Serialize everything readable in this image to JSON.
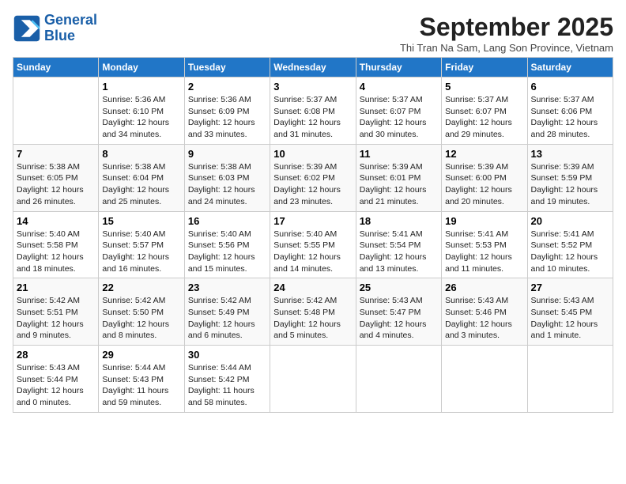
{
  "logo": {
    "line1": "General",
    "line2": "Blue"
  },
  "title": "September 2025",
  "subtitle": "Thi Tran Na Sam, Lang Son Province, Vietnam",
  "weekdays": [
    "Sunday",
    "Monday",
    "Tuesday",
    "Wednesday",
    "Thursday",
    "Friday",
    "Saturday"
  ],
  "weeks": [
    [
      {
        "day": "",
        "text": ""
      },
      {
        "day": "1",
        "text": "Sunrise: 5:36 AM\nSunset: 6:10 PM\nDaylight: 12 hours\nand 34 minutes."
      },
      {
        "day": "2",
        "text": "Sunrise: 5:36 AM\nSunset: 6:09 PM\nDaylight: 12 hours\nand 33 minutes."
      },
      {
        "day": "3",
        "text": "Sunrise: 5:37 AM\nSunset: 6:08 PM\nDaylight: 12 hours\nand 31 minutes."
      },
      {
        "day": "4",
        "text": "Sunrise: 5:37 AM\nSunset: 6:07 PM\nDaylight: 12 hours\nand 30 minutes."
      },
      {
        "day": "5",
        "text": "Sunrise: 5:37 AM\nSunset: 6:07 PM\nDaylight: 12 hours\nand 29 minutes."
      },
      {
        "day": "6",
        "text": "Sunrise: 5:37 AM\nSunset: 6:06 PM\nDaylight: 12 hours\nand 28 minutes."
      }
    ],
    [
      {
        "day": "7",
        "text": "Sunrise: 5:38 AM\nSunset: 6:05 PM\nDaylight: 12 hours\nand 26 minutes."
      },
      {
        "day": "8",
        "text": "Sunrise: 5:38 AM\nSunset: 6:04 PM\nDaylight: 12 hours\nand 25 minutes."
      },
      {
        "day": "9",
        "text": "Sunrise: 5:38 AM\nSunset: 6:03 PM\nDaylight: 12 hours\nand 24 minutes."
      },
      {
        "day": "10",
        "text": "Sunrise: 5:39 AM\nSunset: 6:02 PM\nDaylight: 12 hours\nand 23 minutes."
      },
      {
        "day": "11",
        "text": "Sunrise: 5:39 AM\nSunset: 6:01 PM\nDaylight: 12 hours\nand 21 minutes."
      },
      {
        "day": "12",
        "text": "Sunrise: 5:39 AM\nSunset: 6:00 PM\nDaylight: 12 hours\nand 20 minutes."
      },
      {
        "day": "13",
        "text": "Sunrise: 5:39 AM\nSunset: 5:59 PM\nDaylight: 12 hours\nand 19 minutes."
      }
    ],
    [
      {
        "day": "14",
        "text": "Sunrise: 5:40 AM\nSunset: 5:58 PM\nDaylight: 12 hours\nand 18 minutes."
      },
      {
        "day": "15",
        "text": "Sunrise: 5:40 AM\nSunset: 5:57 PM\nDaylight: 12 hours\nand 16 minutes."
      },
      {
        "day": "16",
        "text": "Sunrise: 5:40 AM\nSunset: 5:56 PM\nDaylight: 12 hours\nand 15 minutes."
      },
      {
        "day": "17",
        "text": "Sunrise: 5:40 AM\nSunset: 5:55 PM\nDaylight: 12 hours\nand 14 minutes."
      },
      {
        "day": "18",
        "text": "Sunrise: 5:41 AM\nSunset: 5:54 PM\nDaylight: 12 hours\nand 13 minutes."
      },
      {
        "day": "19",
        "text": "Sunrise: 5:41 AM\nSunset: 5:53 PM\nDaylight: 12 hours\nand 11 minutes."
      },
      {
        "day": "20",
        "text": "Sunrise: 5:41 AM\nSunset: 5:52 PM\nDaylight: 12 hours\nand 10 minutes."
      }
    ],
    [
      {
        "day": "21",
        "text": "Sunrise: 5:42 AM\nSunset: 5:51 PM\nDaylight: 12 hours\nand 9 minutes."
      },
      {
        "day": "22",
        "text": "Sunrise: 5:42 AM\nSunset: 5:50 PM\nDaylight: 12 hours\nand 8 minutes."
      },
      {
        "day": "23",
        "text": "Sunrise: 5:42 AM\nSunset: 5:49 PM\nDaylight: 12 hours\nand 6 minutes."
      },
      {
        "day": "24",
        "text": "Sunrise: 5:42 AM\nSunset: 5:48 PM\nDaylight: 12 hours\nand 5 minutes."
      },
      {
        "day": "25",
        "text": "Sunrise: 5:43 AM\nSunset: 5:47 PM\nDaylight: 12 hours\nand 4 minutes."
      },
      {
        "day": "26",
        "text": "Sunrise: 5:43 AM\nSunset: 5:46 PM\nDaylight: 12 hours\nand 3 minutes."
      },
      {
        "day": "27",
        "text": "Sunrise: 5:43 AM\nSunset: 5:45 PM\nDaylight: 12 hours\nand 1 minute."
      }
    ],
    [
      {
        "day": "28",
        "text": "Sunrise: 5:43 AM\nSunset: 5:44 PM\nDaylight: 12 hours\nand 0 minutes."
      },
      {
        "day": "29",
        "text": "Sunrise: 5:44 AM\nSunset: 5:43 PM\nDaylight: 11 hours\nand 59 minutes."
      },
      {
        "day": "30",
        "text": "Sunrise: 5:44 AM\nSunset: 5:42 PM\nDaylight: 11 hours\nand 58 minutes."
      },
      {
        "day": "",
        "text": ""
      },
      {
        "day": "",
        "text": ""
      },
      {
        "day": "",
        "text": ""
      },
      {
        "day": "",
        "text": ""
      }
    ]
  ]
}
